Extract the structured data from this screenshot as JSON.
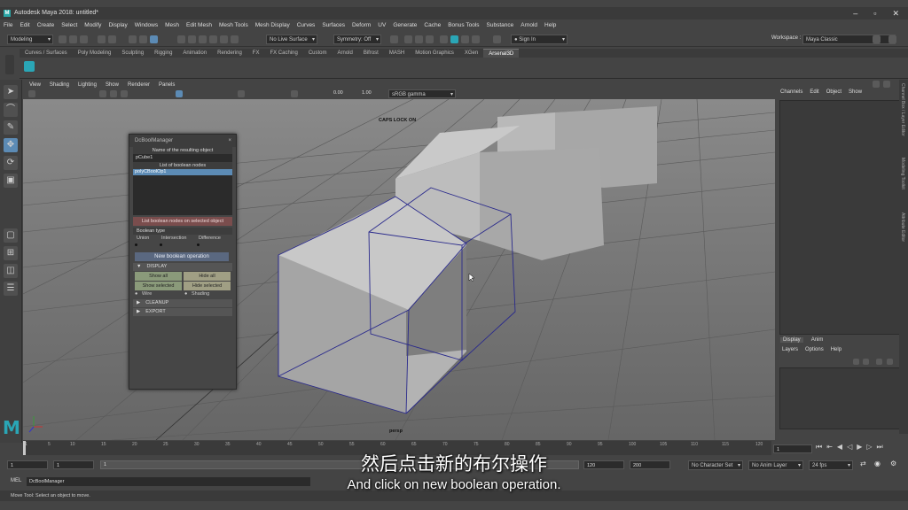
{
  "window": {
    "title": "Autodesk Maya 2018: untitled*",
    "logo": "M"
  },
  "menus": [
    "File",
    "Edit",
    "Create",
    "Select",
    "Modify",
    "Display",
    "Windows",
    "Mesh",
    "Edit Mesh",
    "Mesh Tools",
    "Mesh Display",
    "Curves",
    "Surfaces",
    "Deform",
    "UV",
    "Generate",
    "Cache",
    "Bonus Tools",
    "Substance",
    "Arnold",
    "Help"
  ],
  "status": {
    "mode": "Modeling",
    "live_surface": "No Live Surface",
    "symmetry": "Symmetry: Off",
    "sign_in": "Sign In",
    "workspace_label": "Workspace :",
    "workspace": "Maya Classic"
  },
  "shelf_tabs": [
    "Curves / Surfaces",
    "Poly Modeling",
    "Sculpting",
    "Rigging",
    "Animation",
    "Rendering",
    "FX",
    "FX Caching",
    "Custom",
    "Arnold",
    "Bifrost",
    "MASH",
    "Motion Graphics",
    "XGen",
    "Arsenal3D"
  ],
  "viewport": {
    "menus": [
      "View",
      "Shading",
      "Lighting",
      "Show",
      "Renderer",
      "Panels"
    ],
    "exposure": "0.00",
    "gamma": "1.00",
    "color_space": "sRGB gamma",
    "caps_lock": "CAPS LOCK ON",
    "camera": "persp"
  },
  "dcbool": {
    "title": "DcBoolManager",
    "close": "×",
    "result_label": "Name of the resulting object",
    "result_value": "pCube1",
    "list_label": "List of boolean nodes",
    "list_items": [
      "polyCBoolOp1"
    ],
    "list_selected_btn": "List boolean nodes on selected object",
    "boolean_type_label": "Boolean type",
    "types": [
      "Union",
      "Intersection",
      "Difference"
    ],
    "new_op": "New boolean operation",
    "display_section": "DISPLAY",
    "show_all": "Show all",
    "hide_all": "Hide all",
    "show_selected": "Show selected",
    "hide_selected": "Hide selected",
    "wire": "Wire",
    "shading": "Shading",
    "cleanup_section": "CLEANUP",
    "export_section": "EXPORT"
  },
  "channel_box": {
    "menus": [
      "Channels",
      "Edit",
      "Object",
      "Show"
    ],
    "layer_tabs": [
      "Display",
      "Anim"
    ],
    "layer_menus": [
      "Layers",
      "Options",
      "Help"
    ],
    "side_tabs": [
      "Channel Box / Layer Editor",
      "Modeling Toolkit",
      "Attribute Editor"
    ]
  },
  "timeline": {
    "ticks": [
      "1",
      "5",
      "10",
      "15",
      "20",
      "25",
      "30",
      "35",
      "40",
      "45",
      "50",
      "55",
      "60",
      "65",
      "70",
      "75",
      "80",
      "85",
      "90",
      "95",
      "100",
      "105",
      "110",
      "115",
      "120"
    ],
    "current_frame": "1"
  },
  "range": {
    "start": "1",
    "start2": "1",
    "range_field": "1",
    "end": "120",
    "end2": "120",
    "end3": "200",
    "character_set": "No Character Set",
    "anim_layer": "No Anim Layer",
    "fps": "24 fps"
  },
  "mel": {
    "label": "MEL",
    "command": "DcBoolManager"
  },
  "help_line": "Move Tool: Select an object to move.",
  "subtitles": {
    "chinese": "然后点击新的布尔操作",
    "english": "And click on new boolean operation."
  },
  "colors": {
    "accent": "#2aa6b6",
    "selection": "#5c8bb5",
    "wireframe": "#2a2a8c"
  }
}
